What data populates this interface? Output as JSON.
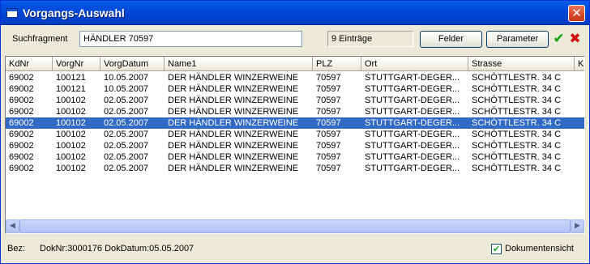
{
  "window": {
    "title": "Vorgangs-Auswahl",
    "close_glyph": "✕"
  },
  "toolbar": {
    "search_label": "Suchfragment",
    "search_value": "HÄNDLER 70597",
    "count_text": "9  Einträge",
    "felder_label": "Felder",
    "parameter_label": "Parameter",
    "ok_icon": "✔",
    "cancel_icon": "✖"
  },
  "table": {
    "columns": [
      "KdNr",
      "VorgNr",
      "VorgDatum",
      "Name1",
      "PLZ",
      "Ort",
      "Strasse",
      "Ko"
    ],
    "selected_index": 4,
    "rows": [
      [
        "69002",
        "100121",
        "10.05.2007",
        "DER HÄNDLER WINZERWEINE",
        "70597",
        "STUTTGART-DEGER...",
        "SCHÖTTLESTR. 34 C"
      ],
      [
        "69002",
        "100121",
        "10.05.2007",
        "DER HÄNDLER WINZERWEINE",
        "70597",
        "STUTTGART-DEGER...",
        "SCHÖTTLESTR. 34 C"
      ],
      [
        "69002",
        "100102",
        "02.05.2007",
        "DER HÄNDLER WINZERWEINE",
        "70597",
        "STUTTGART-DEGER...",
        "SCHÖTTLESTR. 34 C"
      ],
      [
        "69002",
        "100102",
        "02.05.2007",
        "DER HÄNDLER WINZERWEINE",
        "70597",
        "STUTTGART-DEGER...",
        "SCHÖTTLESTR. 34 C"
      ],
      [
        "69002",
        "100102",
        "02.05.2007",
        "DER HÄNDLER WINZERWEINE",
        "70597",
        "STUTTGART-DEGER...",
        "SCHÖTTLESTR. 34 C"
      ],
      [
        "69002",
        "100102",
        "02.05.2007",
        "DER HÄNDLER WINZERWEINE",
        "70597",
        "STUTTGART-DEGER...",
        "SCHÖTTLESTR. 34 C"
      ],
      [
        "69002",
        "100102",
        "02.05.2007",
        "DER HÄNDLER WINZERWEINE",
        "70597",
        "STUTTGART-DEGER...",
        "SCHÖTTLESTR. 34 C"
      ],
      [
        "69002",
        "100102",
        "02.05.2007",
        "DER HÄNDLER WINZERWEINE",
        "70597",
        "STUTTGART-DEGER...",
        "SCHÖTTLESTR. 34 C"
      ],
      [
        "69002",
        "100102",
        "02.05.2007",
        "DER HÄNDLER WINZERWEINE",
        "70597",
        "STUTTGART-DEGER...",
        "SCHÖTTLESTR. 34 C"
      ]
    ]
  },
  "scrollbar": {
    "left_arrow": "◀",
    "right_arrow": "▶"
  },
  "status": {
    "bez_label": "Bez:",
    "bez_value": "DokNr:3000176 DokDatum:05.05.2007",
    "checkbox_checked": true,
    "checkbox_mark": "✔",
    "checkbox_label": "Dokumentensicht"
  },
  "colors": {
    "titlebar": "#0055e5",
    "selection": "#316ac5",
    "window_bg": "#ece9d8"
  }
}
